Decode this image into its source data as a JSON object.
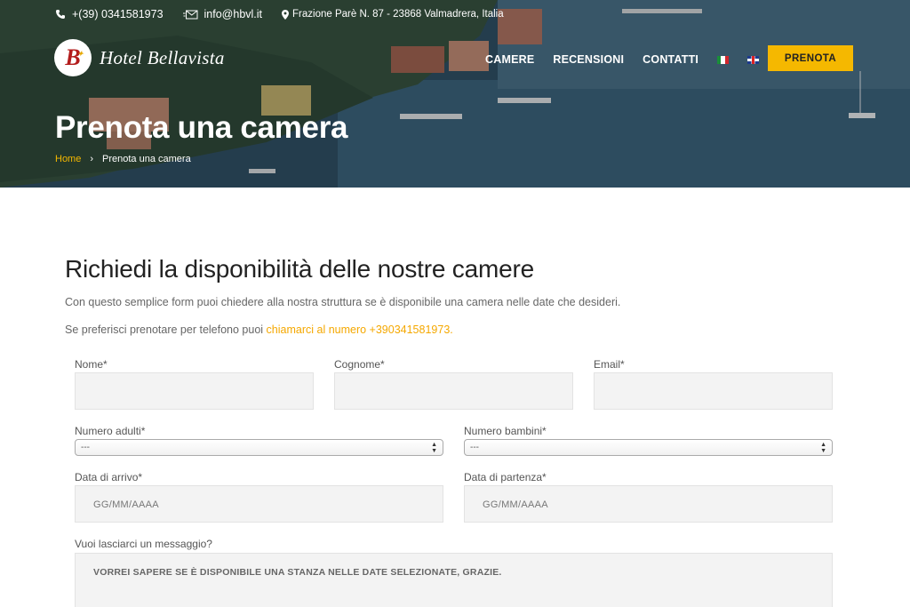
{
  "topbar": {
    "phone": "+(39) 0341581973",
    "email": "info@hbvl.it",
    "address": "Frazione Parè N. 87 - 23868 Valmadrera, Italia"
  },
  "brand": {
    "logo_letter": "B",
    "name": "Hotel Bellavista"
  },
  "nav": {
    "items": [
      "CAMERE",
      "RECENSIONI",
      "CONTATTI"
    ],
    "languages": [
      "it-flag-icon",
      "en-flag-icon"
    ],
    "cta": "PRENOTA"
  },
  "hero": {
    "title": "Prenota una camera",
    "breadcrumb": {
      "home": "Home",
      "separator": "›",
      "current": "Prenota una camera"
    }
  },
  "section": {
    "title": "Richiedi la disponibilità delle nostre camere",
    "intro": "Con questo semplice form puoi chiedere alla nostra struttura se è disponibile una camera nelle date che desideri.",
    "phone_prefix": "Se preferisci prenotare per telefono puoi ",
    "phone_link": "chiamarci al numero +390341581973."
  },
  "form": {
    "nome_label": "Nome*",
    "cognome_label": "Cognome*",
    "email_label": "Email*",
    "adulti_label": "Numero adulti*",
    "adulti_value": "---",
    "bambini_label": "Numero bambini*",
    "bambini_value": "---",
    "arrivo_label": "Data di arrivo*",
    "arrivo_placeholder": "GG/MM/AAAA",
    "partenza_label": "Data di partenza*",
    "partenza_placeholder": "GG/MM/AAAA",
    "messaggio_label": "Vuoi lasciarci un messaggio?",
    "messaggio_value": "VORREI SAPERE SE È DISPONIBILE UNA STANZA NELLE DATE SELEZIONATE, GRAZIE."
  },
  "colors": {
    "accent": "#f5b800",
    "link": "#f5a800",
    "field_bg": "#f3f3f3"
  }
}
